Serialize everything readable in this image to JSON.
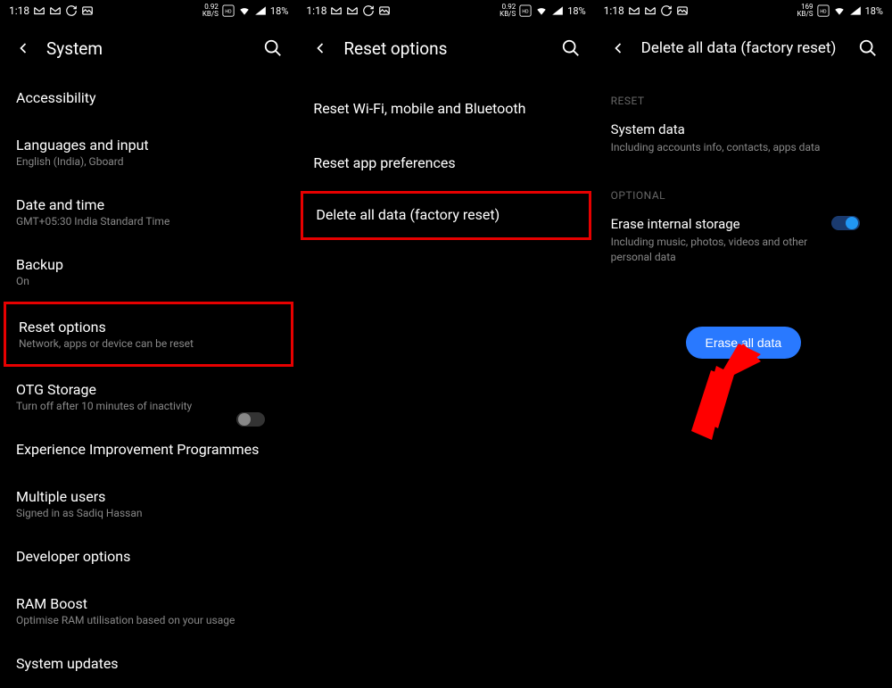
{
  "status": {
    "time": "1:18",
    "battery": "18%",
    "net_speed_1": "0.92",
    "net_speed_unit": "KB/S",
    "net_speed_3": "169"
  },
  "screen1": {
    "title": "System",
    "items": [
      {
        "title": "Accessibility",
        "sub": ""
      },
      {
        "title": "Languages and input",
        "sub": "English (India), Gboard"
      },
      {
        "title": "Date and time",
        "sub": "GMT+05:30 India Standard Time"
      },
      {
        "title": "Backup",
        "sub": "On"
      },
      {
        "title": "Reset options",
        "sub": "Network, apps or device can be reset"
      },
      {
        "title": "OTG Storage",
        "sub": "Turn off after 10 minutes of inactivity"
      },
      {
        "title": "Experience Improvement Programmes",
        "sub": ""
      },
      {
        "title": "Multiple users",
        "sub": "Signed in as Sadiq Hassan"
      },
      {
        "title": "Developer options",
        "sub": ""
      },
      {
        "title": "RAM Boost",
        "sub": "Optimise RAM utilisation based on your usage"
      },
      {
        "title": "System updates",
        "sub": ""
      }
    ]
  },
  "screen2": {
    "title": "Reset options",
    "items": [
      {
        "title": "Reset Wi-Fi, mobile and Bluetooth"
      },
      {
        "title": "Reset app preferences"
      },
      {
        "title": "Delete all data (factory reset)"
      }
    ]
  },
  "screen3": {
    "title": "Delete all data (factory reset)",
    "section_reset": "RESET",
    "system_data_title": "System data",
    "system_data_sub": "Including accounts info, contacts, apps data",
    "section_optional": "OPTIONAL",
    "erase_storage_title": "Erase internal storage",
    "erase_storage_sub": "Including music, photos, videos and other personal data",
    "erase_button": "Erase all data"
  }
}
